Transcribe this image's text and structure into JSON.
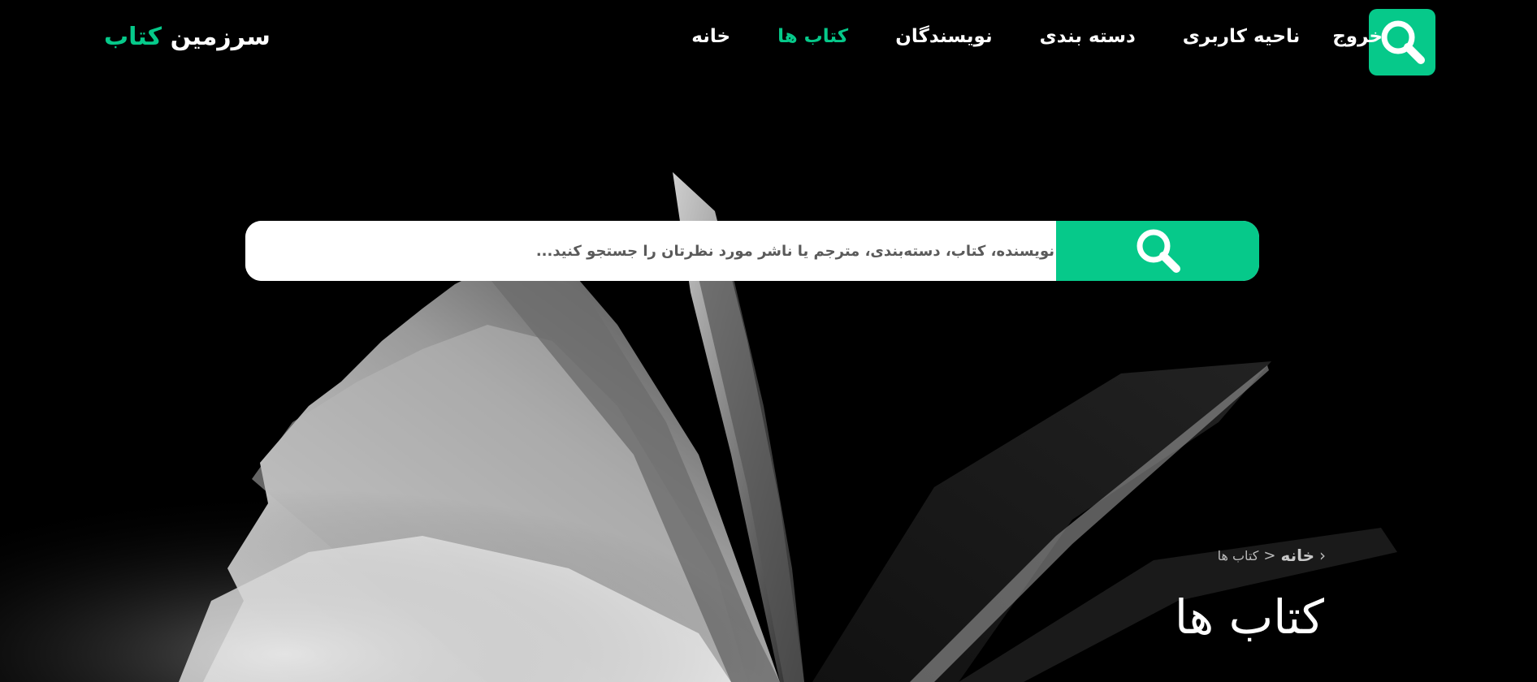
{
  "header": {
    "logo_main": "سرزمین",
    "logo_accent": "کتاب",
    "nav": [
      {
        "label": "خروج",
        "active": false
      },
      {
        "label": "ناحیه کاربری",
        "active": false
      },
      {
        "label": "دسته بندی",
        "active": false
      },
      {
        "label": "نویسندگان",
        "active": false
      },
      {
        "label": "کتاب ها",
        "active": true
      },
      {
        "label": "خانه",
        "active": false
      }
    ],
    "search_icon": "search-icon"
  },
  "search": {
    "placeholder": "نویسنده، کتاب، دسته‌بندی، مترجم یا ناشر مورد نظرتان را جستجو کنید...",
    "value": "",
    "submit_icon": "search-icon"
  },
  "breadcrumb": {
    "icon": "chevron-left-icon",
    "home": "خانه",
    "separator": "<",
    "current": "کتاب ها"
  },
  "page_title": "کتاب ها",
  "colors": {
    "accent": "#06c98a",
    "background": "#000000",
    "text": "#ffffff"
  }
}
